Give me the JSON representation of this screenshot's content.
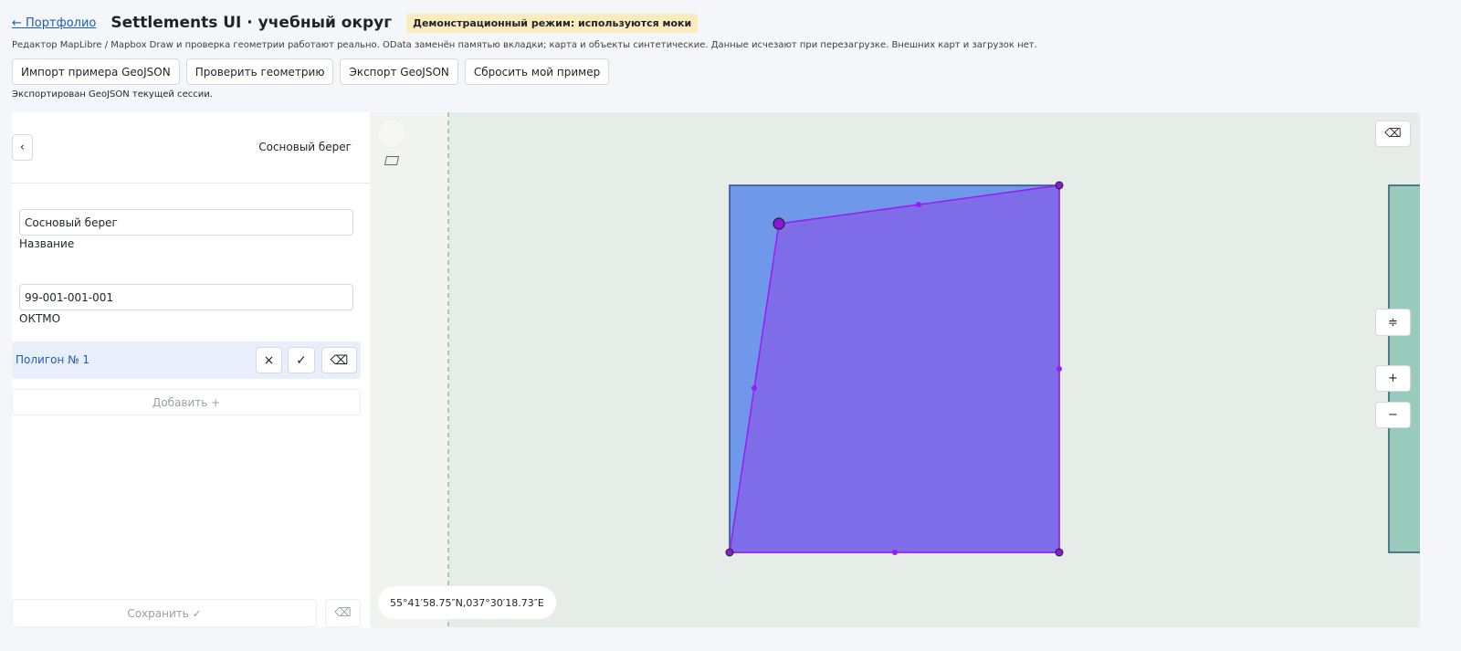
{
  "header": {
    "back_link": "← Портфолио",
    "title": "Settlements UI · учебный округ",
    "demo_badge": "Демонстрационный режим: используются моки",
    "description": "Редактор MapLibre / Mapbox Draw и проверка геометрии работают реально. OData заменён памятью вкладки; карта и объекты синтетические. Данные исчезают при перезагрузке. Внешних карт и загрузок нет."
  },
  "toolbar": {
    "import_label": "Импорт примера GeoJSON",
    "check_label": "Проверить геометрию",
    "export_label": "Экспорт GeoJSON",
    "reset_label": "Сбросить мой пример"
  },
  "status": "Экспортирован GeoJSON текущей сессии.",
  "sidebar": {
    "back_glyph": "‹",
    "title": "Сосновый берег",
    "name_value": "Сосновый берег",
    "name_label": "Название",
    "oktmo_value": "99-001-001-001",
    "oktmo_label": "ОКТМО",
    "polygon_label": "Полигон № 1",
    "polygon_cancel_glyph": "×",
    "polygon_confirm_glyph": "✓",
    "polygon_delete_glyph": "⌫",
    "add_label": "Добавить +",
    "save_label": "Сохранить ✓",
    "delete_glyph": "⌫"
  },
  "map": {
    "trash_glyph": "⌫",
    "compass_glyph": "≑",
    "zoom_in_glyph": "+",
    "zoom_out_glyph": "−",
    "coordinates": "55°41′58.75″N,037°30′18.73″E"
  },
  "colors": {
    "accent": "#1a5fb4",
    "polygon_original": "#6f98ea",
    "polygon_edit_fill": "#7e6ce9",
    "polygon_edit_stroke": "#9b1cf0",
    "neighbor_fill": "#98cbbb",
    "demo_badge": "#fbecc0"
  }
}
